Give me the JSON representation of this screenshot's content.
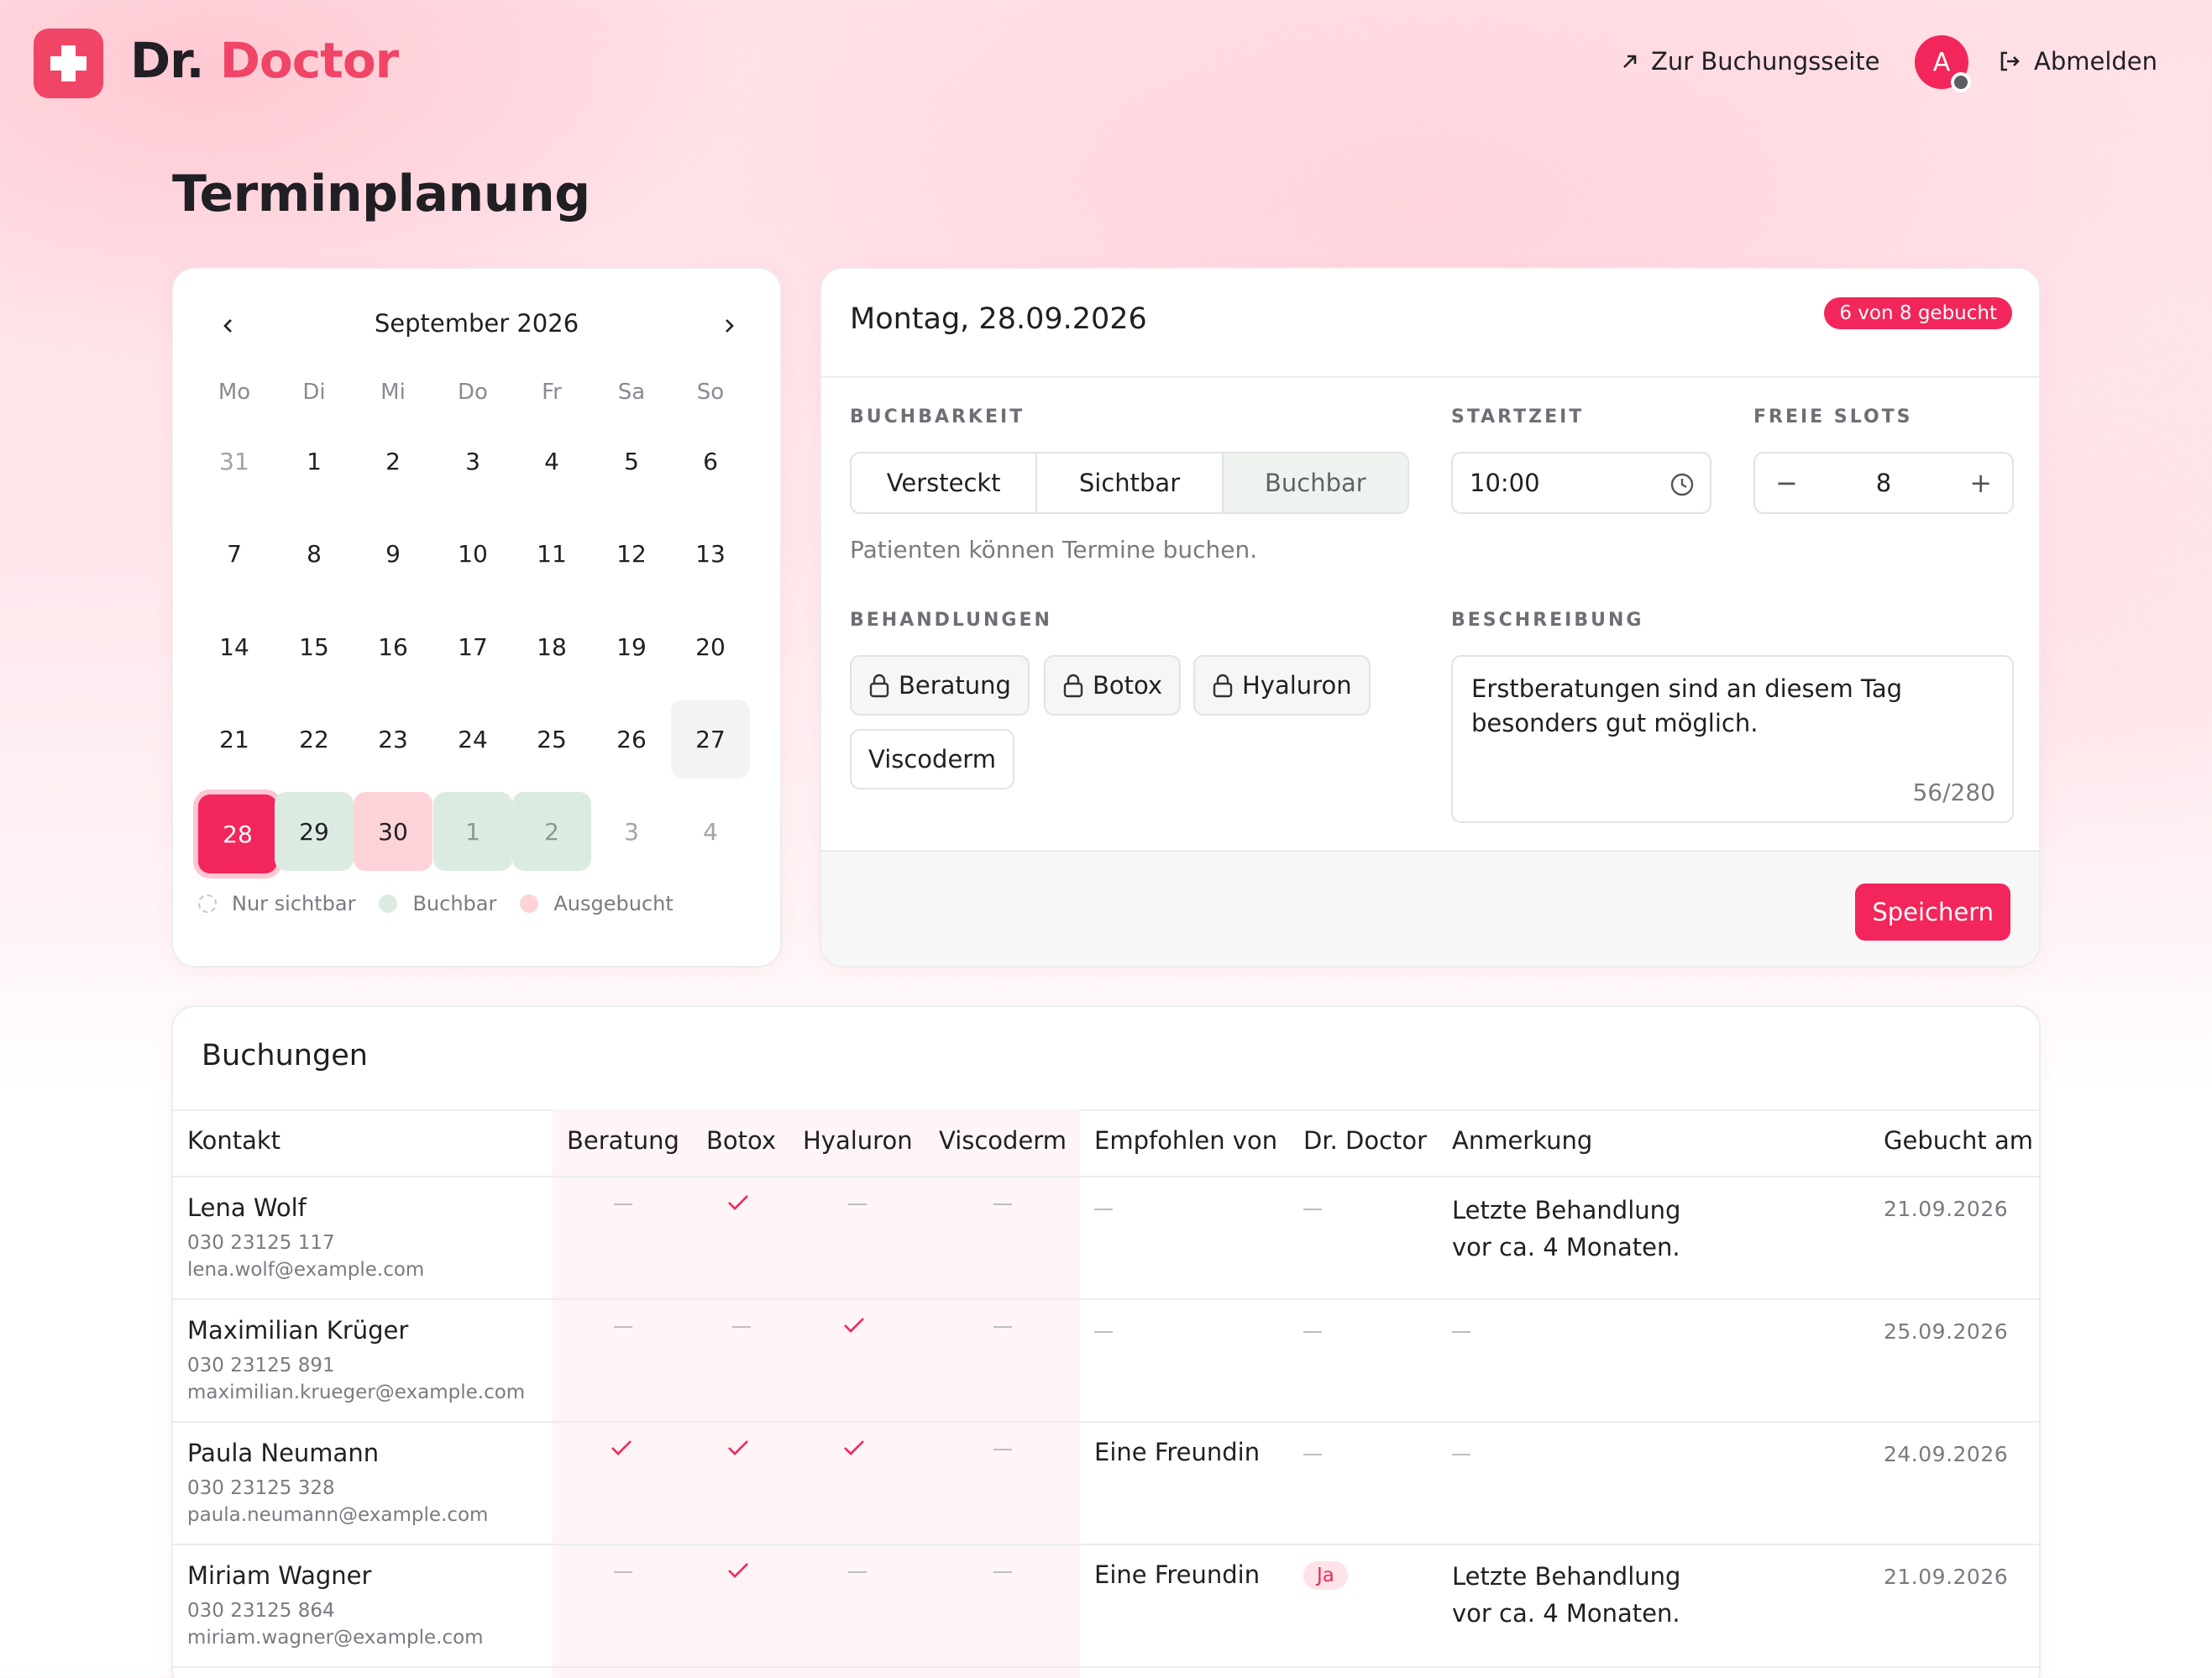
{
  "header": {
    "brand_prefix": "Dr.",
    "brand_name": "Doctor",
    "booking_link": "Zur Buchungsseite",
    "avatar_initial": "A",
    "logout": "Abmelden"
  },
  "page_title": "Terminplanung",
  "calendar": {
    "month_label": "September 2026",
    "weekdays": [
      "Mo",
      "Di",
      "Mi",
      "Do",
      "Fr",
      "Sa",
      "So"
    ],
    "weeks": [
      [
        "31",
        "1",
        "2",
        "3",
        "4",
        "5",
        "6"
      ],
      [
        "7",
        "8",
        "9",
        "10",
        "11",
        "12",
        "13"
      ],
      [
        "14",
        "15",
        "16",
        "17",
        "18",
        "19",
        "20"
      ],
      [
        "21",
        "22",
        "23",
        "24",
        "25",
        "26",
        "27"
      ],
      [
        "28",
        "29",
        "30",
        "1",
        "2",
        "3",
        "4"
      ]
    ],
    "legend": {
      "visible": "Nur sichtbar",
      "bookable": "Buchbar",
      "full": "Ausgebucht"
    }
  },
  "day_panel": {
    "title": "Montag, 28.09.2026",
    "booked_badge": "6 von 8 gebucht",
    "bookability_label": "BUCHBARKEIT",
    "bookability_options": [
      "Versteckt",
      "Sichtbar",
      "Buchbar"
    ],
    "bookability_selected": "Buchbar",
    "bookability_hint": "Patienten können Termine buchen.",
    "start_label": "STARTZEIT",
    "start_value": "10:00",
    "slots_label": "FREIE SLOTS",
    "slots_value": "8",
    "treatments_label": "BEHANDLUNGEN",
    "treatments": [
      "Beratung",
      "Botox",
      "Hyaluron",
      "Viscoderm"
    ],
    "description_label": "BESCHREIBUNG",
    "description_line1": "Erstberatungen sind an diesem Tag",
    "description_line2": "besonders gut möglich.",
    "description_counter": "56/280",
    "save": "Speichern"
  },
  "bookings": {
    "title": "Buchungen",
    "columns": [
      "Kontakt",
      "Beratung",
      "Botox",
      "Hyaluron",
      "Viscoderm",
      "Empfohlen von",
      "Dr. Doctor",
      "Anmerkung",
      "Gebucht am"
    ],
    "rows": [
      {
        "name": "Lena Wolf",
        "phone": "030 23125 117",
        "email": "lena.wolf@example.com",
        "referred_by": "",
        "dr_doctor": "",
        "note_line1": "Letzte Behandlung",
        "note_line2": "vor ca. 4 Monaten.",
        "booked_at": "21.09.2026"
      },
      {
        "name": "Maximilian Krüger",
        "phone": "030 23125 891",
        "email": "maximilian.krueger@example.com",
        "referred_by": "",
        "dr_doctor": "",
        "note_line1": "",
        "note_line2": "",
        "booked_at": "25.09.2026"
      },
      {
        "name": "Paula Neumann",
        "phone": "030 23125 328",
        "email": "paula.neumann@example.com",
        "referred_by": "Eine Freundin",
        "dr_doctor": "",
        "note_line1": "",
        "note_line2": "",
        "booked_at": "24.09.2026"
      },
      {
        "name": "Miriam Wagner",
        "phone": "030 23125 864",
        "email": "miriam.wagner@example.com",
        "referred_by": "Eine Freundin",
        "dr_doctor": "Ja",
        "note_line1": "Letzte Behandlung",
        "note_line2": "vor ca. 4 Monaten.",
        "booked_at": "21.09.2026"
      }
    ]
  },
  "colors": {
    "accent": "#f2265a",
    "brand": "#f04566",
    "bookable": "#dcebe2",
    "full": "#fdd3d9"
  }
}
